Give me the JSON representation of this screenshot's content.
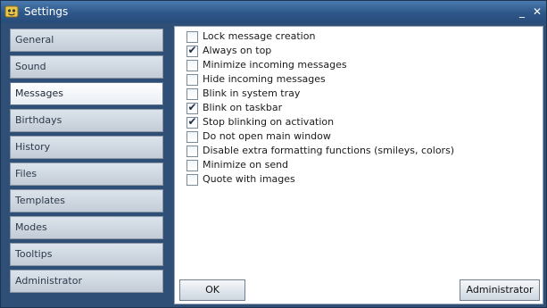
{
  "window": {
    "title": "Settings",
    "minimize_glyph": "_",
    "close_glyph": "✕",
    "app_icon": "settings-app-icon"
  },
  "sidebar": {
    "items": [
      {
        "label": "General",
        "active": false
      },
      {
        "label": "Sound",
        "active": false
      },
      {
        "label": "Messages",
        "active": true
      },
      {
        "label": "Birthdays",
        "active": false
      },
      {
        "label": "History",
        "active": false
      },
      {
        "label": "Files",
        "active": false
      },
      {
        "label": "Templates",
        "active": false
      },
      {
        "label": "Modes",
        "active": false
      },
      {
        "label": "Tooltips",
        "active": false
      },
      {
        "label": "Administrator",
        "active": false
      }
    ]
  },
  "options": [
    {
      "label": "Lock message creation",
      "checked": false
    },
    {
      "label": "Always on top",
      "checked": true
    },
    {
      "label": "Minimize incoming messages",
      "checked": false
    },
    {
      "label": "Hide incoming messages",
      "checked": false
    },
    {
      "label": "Blink in system tray",
      "checked": false
    },
    {
      "label": "Blink on taskbar",
      "checked": true
    },
    {
      "label": "Stop blinking on activation",
      "checked": true
    },
    {
      "label": "Do not open main window",
      "checked": false
    },
    {
      "label": "Disable extra formatting functions (smileys, colors)",
      "checked": false
    },
    {
      "label": "Minimize on send",
      "checked": false
    },
    {
      "label": "Quote with images",
      "checked": false
    }
  ],
  "check_glyph": "✔",
  "buttons": {
    "ok_label": "OK",
    "admin_label": "Administrator"
  },
  "colors": {
    "window_bg": "#2f4f76",
    "titlebar": "#2d5688",
    "active_tab": "#ffffff"
  }
}
